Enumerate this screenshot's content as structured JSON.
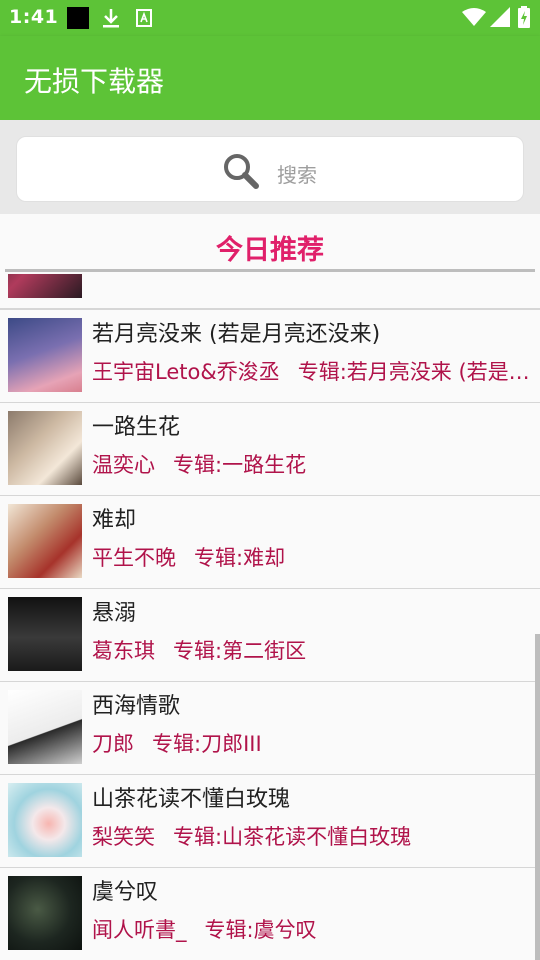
{
  "status_bar": {
    "time": "1:41",
    "icons": [
      "app-icon",
      "download-icon",
      "accessibility-icon",
      "wifi-icon",
      "signal-icon",
      "battery-icon"
    ]
  },
  "app_bar": {
    "title": "无损下载器",
    "color": "#5dc337"
  },
  "search": {
    "placeholder": "搜索"
  },
  "section": {
    "title": "今日推荐",
    "color": "#e0206a"
  },
  "songs": [
    {
      "title": "",
      "artist": "",
      "album": ""
    },
    {
      "title": "若月亮没来 (若是月亮还没来)",
      "artist": "王宇宙Leto&乔浚丞",
      "album": "专辑:若月亮没来 (若是月亮还没来)"
    },
    {
      "title": "一路生花",
      "artist": "温奕心",
      "album": "专辑:一路生花"
    },
    {
      "title": "难却",
      "artist": "平生不晚",
      "album": "专辑:难却"
    },
    {
      "title": "悬溺",
      "artist": "葛东琪",
      "album": "专辑:第二街区"
    },
    {
      "title": "西海情歌",
      "artist": "刀郎",
      "album": "专辑:刀郎III"
    },
    {
      "title": "山茶花读不懂白玫瑰",
      "artist": "梨笑笑",
      "album": "专辑:山茶花读不懂白玫瑰"
    },
    {
      "title": "虞兮叹",
      "artist": "闻人听書_",
      "album": "专辑:虞兮叹"
    }
  ]
}
